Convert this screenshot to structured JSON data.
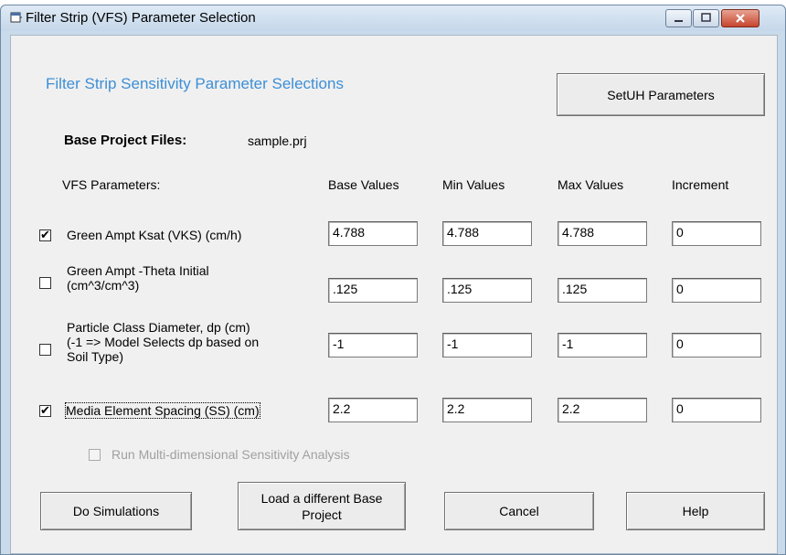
{
  "window": {
    "title": "Filter Strip (VFS) Parameter Selection"
  },
  "header": {
    "heading": "Filter Strip Sensitivity Parameter Selections",
    "setuh_button": "SetUH Parameters",
    "base_project_label": "Base Project Files:",
    "base_project_value": "sample.prj"
  },
  "columns": {
    "params": "VFS Parameters:",
    "base": "Base Values",
    "min": "Min Values",
    "max": "Max Values",
    "increment": "Increment"
  },
  "rows": [
    {
      "checked": true,
      "label_lines": [
        "Green Ampt Ksat (VKS) (cm/h)"
      ],
      "base": "4.788",
      "min": "4.788",
      "max": "4.788",
      "increment": "0"
    },
    {
      "checked": false,
      "label_lines": [
        "Green Ampt -Theta Initial",
        "(cm^3/cm^3)"
      ],
      "base": ".125",
      "min": ".125",
      "max": ".125",
      "increment": "0"
    },
    {
      "checked": false,
      "label_lines": [
        "Particle Class Diameter, dp (cm)",
        "(-1 => Model Selects dp based on",
        "Soil Type)"
      ],
      "base": "-1",
      "min": "-1",
      "max": "-1",
      "increment": "0"
    },
    {
      "checked": true,
      "label_lines": [
        "Media Element Spacing (SS) (cm)"
      ],
      "base": "2.2",
      "min": "2.2",
      "max": "2.2",
      "increment": "0"
    }
  ],
  "multi_dim": {
    "checked": false,
    "enabled": false,
    "label": "Run Multi-dimensional Sensitivity Analysis"
  },
  "buttons": {
    "do_simulations": "Do Simulations",
    "load_base_line1": "Load a different Base",
    "load_base_line2": "Project",
    "cancel": "Cancel",
    "help": "Help"
  }
}
